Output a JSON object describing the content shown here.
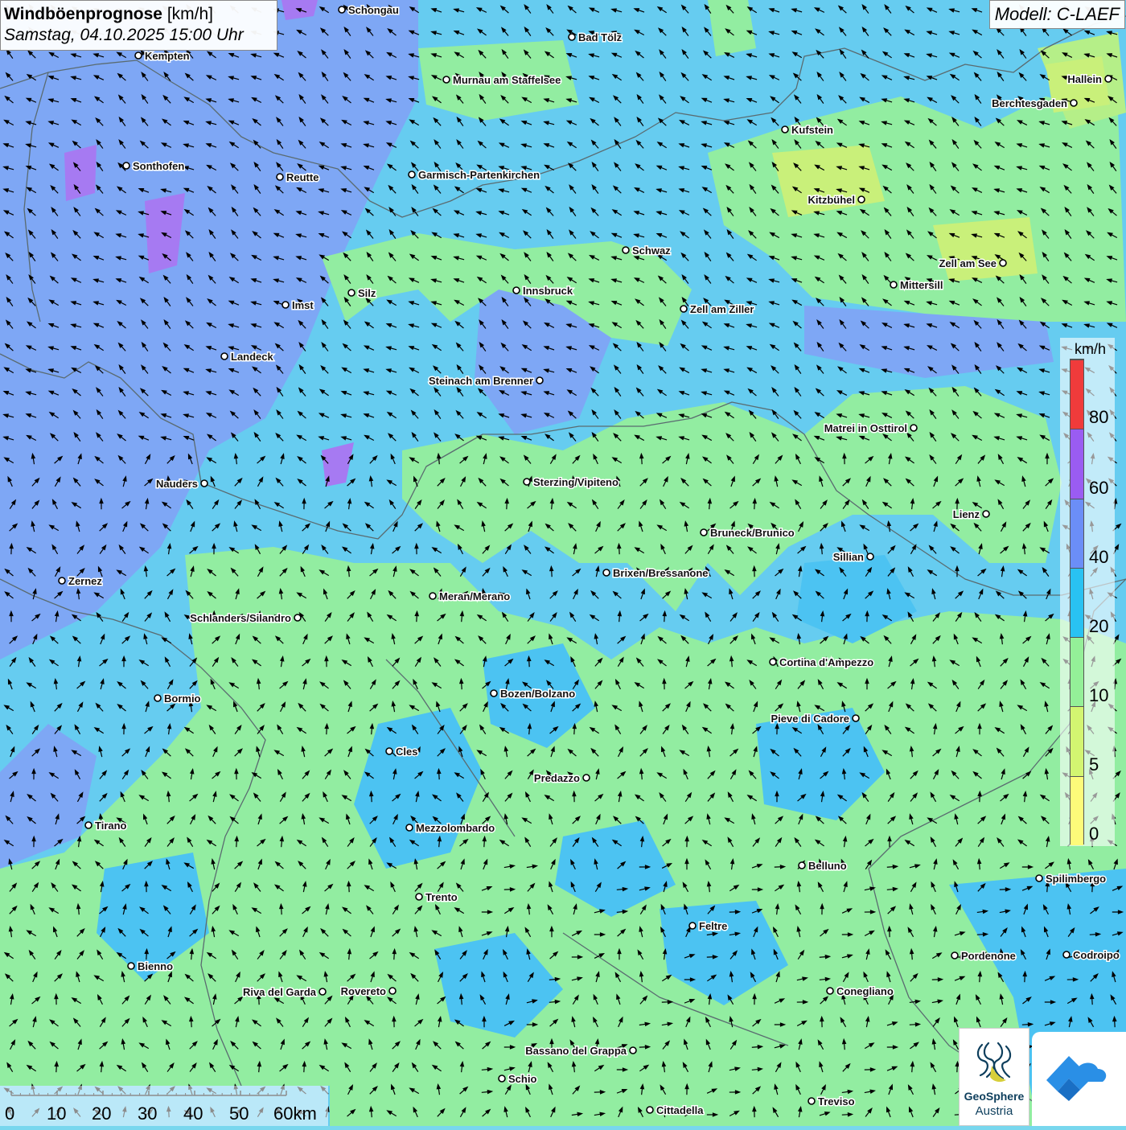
{
  "title": {
    "main": "Windböenprognose",
    "unit": "[km/h]",
    "datetime": "Samstag, 04.10.2025 15:00 Uhr"
  },
  "model": "Modell: C-LAEF",
  "legend": {
    "unit": "km/h",
    "labels": [
      "80",
      "60",
      "40",
      "20",
      "10",
      "5",
      "0"
    ],
    "classes": [
      {
        "min": 0,
        "max": 5,
        "color": "#fdfb7a"
      },
      {
        "min": 5,
        "max": 10,
        "color": "#d3f571"
      },
      {
        "min": 10,
        "max": 20,
        "color": "#94f098"
      },
      {
        "min": 20,
        "max": 40,
        "color": "#29c2f2"
      },
      {
        "min": 40,
        "max": 60,
        "color": "#6b8ef7"
      },
      {
        "min": 60,
        "max": 80,
        "color": "#9a5cf2"
      },
      {
        "min": 80,
        "max": 100,
        "color": "#f03b3b"
      }
    ]
  },
  "scalebar": {
    "labels": [
      "0",
      "10",
      "20",
      "30",
      "40",
      "50",
      "60km"
    ]
  },
  "cities": [
    {
      "name": "Schongau"
    },
    {
      "name": "Bad Tölz"
    },
    {
      "name": "Kempten"
    },
    {
      "name": "Murnau am Staffelsee"
    },
    {
      "name": "Hallein"
    },
    {
      "name": "Berchtesgaden"
    },
    {
      "name": "Kufstein"
    },
    {
      "name": "Sonthofen"
    },
    {
      "name": "Reutte"
    },
    {
      "name": "Garmisch-Partenkirchen"
    },
    {
      "name": "Kitzbühel"
    },
    {
      "name": "Schwaz"
    },
    {
      "name": "Zell am See"
    },
    {
      "name": "Mittersill"
    },
    {
      "name": "Innsbruck"
    },
    {
      "name": "Silz"
    },
    {
      "name": "Imst"
    },
    {
      "name": "Zell am Ziller"
    },
    {
      "name": "Landeck"
    },
    {
      "name": "Steinach am Brenner"
    },
    {
      "name": "Matrei in Osttirol"
    },
    {
      "name": "Nauders"
    },
    {
      "name": "Sterzing/Vipiteno"
    },
    {
      "name": "Lienz"
    },
    {
      "name": "Bruneck/Brunico"
    },
    {
      "name": "Sillian"
    },
    {
      "name": "Zernez"
    },
    {
      "name": "Brixen/Bressanone"
    },
    {
      "name": "Meran/Merano"
    },
    {
      "name": "Schlanders/Silandro"
    },
    {
      "name": "Cortina d'Ampezzo"
    },
    {
      "name": "Bozen/Bolzano"
    },
    {
      "name": "Bormio"
    },
    {
      "name": "Pieve di Cadore"
    },
    {
      "name": "Cles"
    },
    {
      "name": "Predazzo"
    },
    {
      "name": "Tirano"
    },
    {
      "name": "Mezzolombardo"
    },
    {
      "name": "Belluno"
    },
    {
      "name": "Spilimbergo"
    },
    {
      "name": "Trento"
    },
    {
      "name": "Feltre"
    },
    {
      "name": "Bienno"
    },
    {
      "name": "Pordenone"
    },
    {
      "name": "Codroipo"
    },
    {
      "name": "Riva del Garda"
    },
    {
      "name": "Rovereto"
    },
    {
      "name": "Conegliano"
    },
    {
      "name": "Bassano del Grappa"
    },
    {
      "name": "Schio"
    },
    {
      "name": "Treviso"
    },
    {
      "name": "Cittadella"
    }
  ],
  "logos": {
    "geosphere_line1": "GeoSphere",
    "geosphere_line2": "Austria"
  }
}
